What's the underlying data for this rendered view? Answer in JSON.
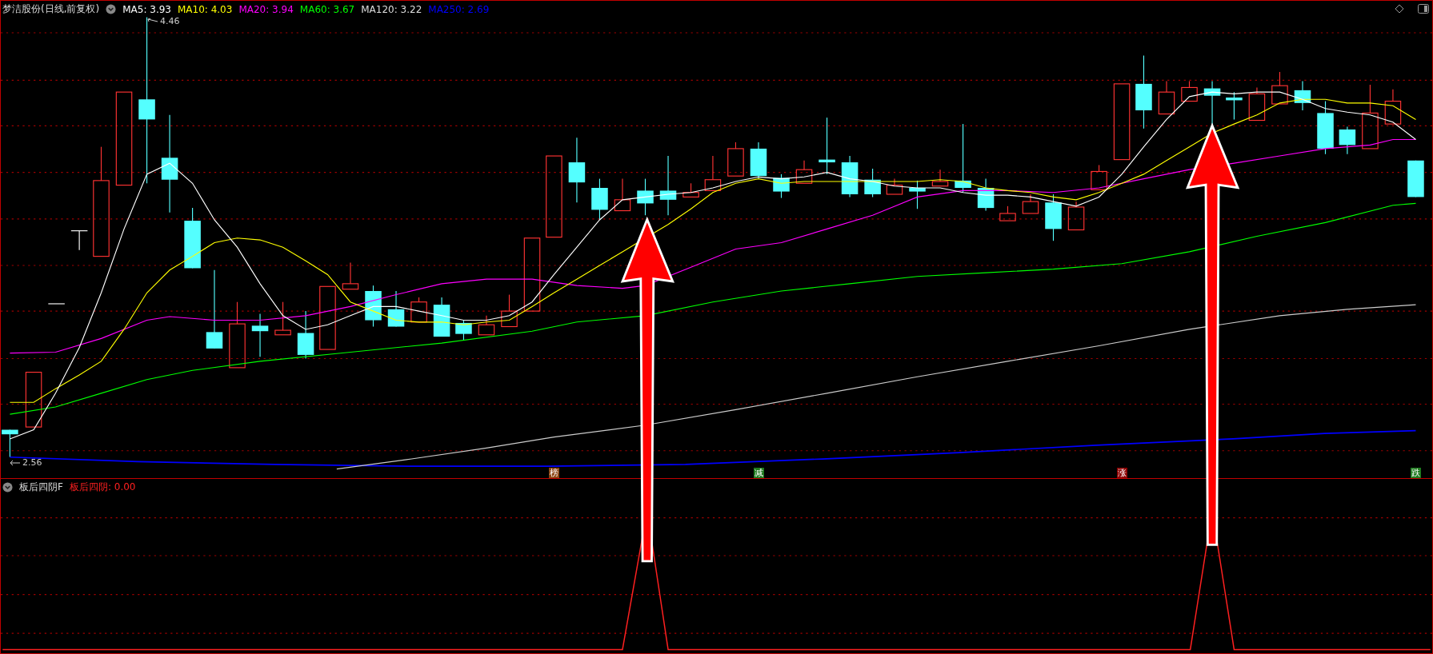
{
  "header": {
    "title": "梦洁股份(日线,前复权)",
    "ma": [
      {
        "label": "MA5: 3.93",
        "color": "#ffffff"
      },
      {
        "label": "MA10: 4.03",
        "color": "#ffff00"
      },
      {
        "label": "MA20: 3.94",
        "color": "#ff00ff"
      },
      {
        "label": "MA60: 3.67",
        "color": "#00ff00"
      },
      {
        "label": "MA120: 3.22",
        "color": "#dddddd"
      },
      {
        "label": "MA250: 2.69",
        "color": "#0000ff"
      }
    ]
  },
  "price_labels": {
    "high": "4.46",
    "low": "2.56"
  },
  "markers": [
    {
      "text": "榜",
      "color": "#8b4513"
    },
    {
      "text": "减",
      "color": "#1e7a1e"
    },
    {
      "text": "涨",
      "color": "#8b0000"
    },
    {
      "text": "跌",
      "color": "#1e7a1e"
    }
  ],
  "indicator": {
    "name": "板后四阴F",
    "reading": "板后四阴: 0.00"
  }
}
